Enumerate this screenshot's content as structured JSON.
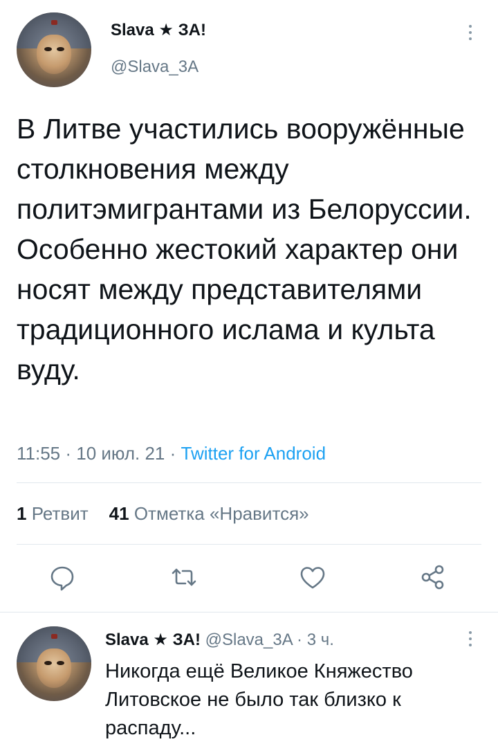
{
  "tweet": {
    "author": {
      "display_name": "Slava ★ ЗА!",
      "handle": "@Slava_3A"
    },
    "text": "В Литве участились вооружённые столкновения между политэмигрантами из Белоруссии. Особенно жестокий характер они носят между представителями традиционного ислама и культа вуду.",
    "time": "11:55",
    "date": "10 июл. 21",
    "source": "Twitter for Android",
    "separator": " · ",
    "stats": {
      "retweets_count": "1",
      "retweets_label": "Ретвит",
      "likes_count": "41",
      "likes_label": "Отметка «Нравится»"
    },
    "actions": [
      "reply-icon",
      "retweet-icon",
      "like-icon",
      "share-icon"
    ]
  },
  "reply": {
    "display_name": "Slava ★ ЗА!",
    "handle": "@Slava_3A",
    "separator": " · ",
    "time_ago": "3 ч.",
    "text": "Никогда ещё Великое Княжество Литовское не было так близко к распаду..."
  },
  "colors": {
    "text": "#0f1419",
    "muted": "#657786",
    "link": "#1da1f2",
    "divider": "#e1e8ed",
    "icon": "#8899a6"
  }
}
